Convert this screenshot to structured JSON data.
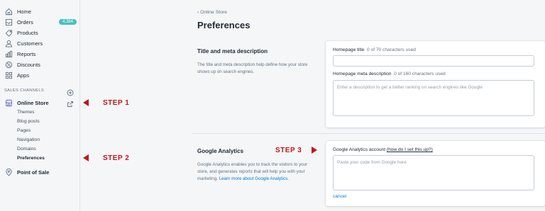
{
  "sidebar": {
    "nav": [
      {
        "label": "Home",
        "icon": "home-icon"
      },
      {
        "label": "Orders",
        "icon": "orders-icon"
      },
      {
        "label": "Products",
        "icon": "products-icon"
      },
      {
        "label": "Customers",
        "icon": "customers-icon"
      },
      {
        "label": "Reports",
        "icon": "reports-icon"
      },
      {
        "label": "Discounts",
        "icon": "discounts-icon"
      },
      {
        "label": "Apps",
        "icon": "apps-icon"
      }
    ],
    "orders_badge": "4,384",
    "sales_channels_label": "SALES CHANNELS",
    "online_store_label": "Online Store",
    "sub_items": [
      "Themes",
      "Blog posts",
      "Pages",
      "Navigation",
      "Domains",
      "Preferences"
    ],
    "point_of_sale_label": "Point of Sale"
  },
  "steps": {
    "step1": "STEP 1",
    "step2": "STEP 2",
    "step3": "STEP 3",
    "color": "#c4141b"
  },
  "main": {
    "breadcrumb": "Online Store",
    "title": "Preferences",
    "meta": {
      "title": "Title and meta description",
      "description": "The title and meta description help define how your store shows up on search engines.",
      "homepage_title_label": "Homepage title",
      "homepage_title_count": "0 of 70 characters used",
      "homepage_title_value": "",
      "meta_desc_label": "Homepage meta description",
      "meta_desc_count": "0 of 160 characters used",
      "meta_desc_placeholder": "Enter a description to get a better ranking on search engines like Google"
    },
    "analytics": {
      "title": "Google Analytics",
      "description": "Google Analytics enables you to track the visitors to your store, and generates reports that will help you with your marketing.",
      "learn_more": "Learn more about Google Analytics.",
      "account_label": "Google Analytics account",
      "help_link": "(how do I set this up?)",
      "code_placeholder": "Paste your code from Google here",
      "cancel_label": "cancel"
    }
  }
}
